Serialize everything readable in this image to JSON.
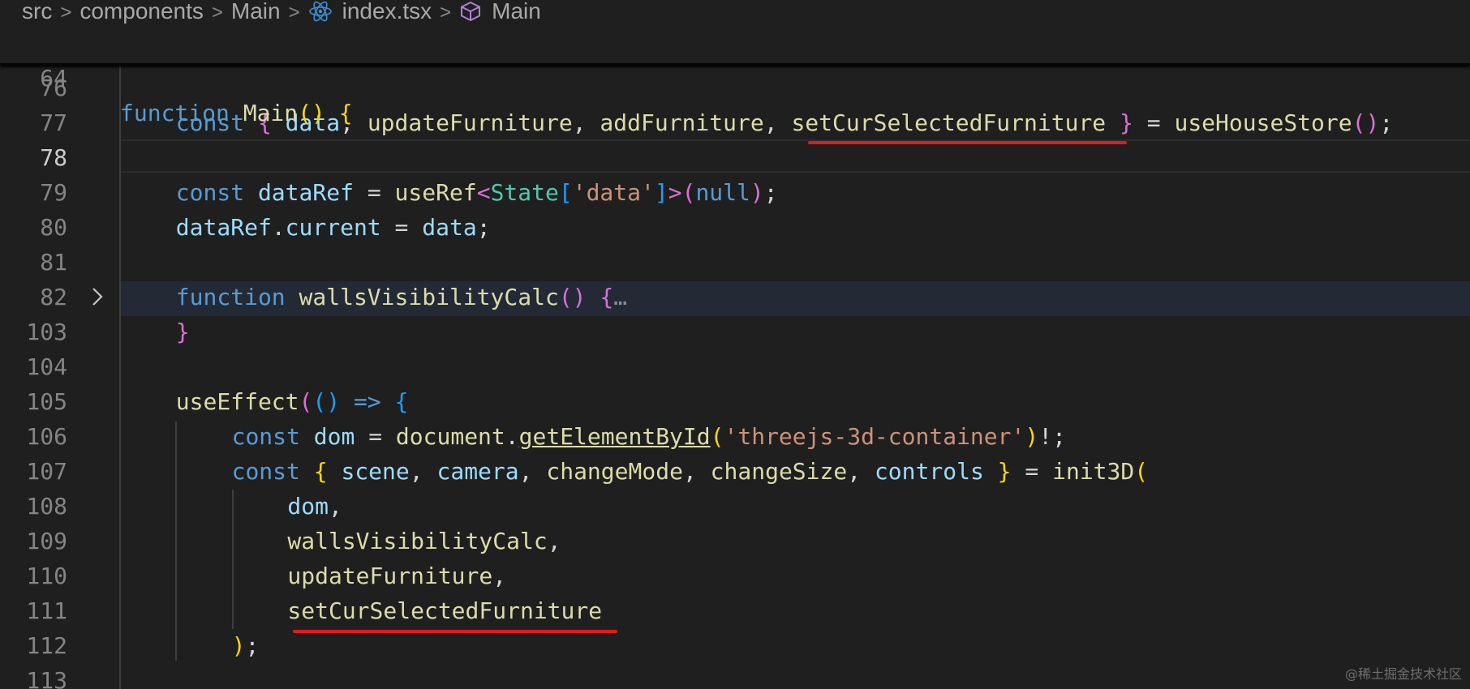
{
  "breadcrumb": {
    "items": [
      "src",
      "components",
      "Main",
      "index.tsx",
      "Main"
    ],
    "separator": ">",
    "file_icon": "react-icon",
    "symbol_icon": "cube-icon"
  },
  "sticky_scroll": {
    "line_number": "64",
    "code": "function Main() {"
  },
  "code_lines": [
    {
      "n": "76",
      "code": ""
    },
    {
      "n": "77",
      "code": "    const { data, updateFurniture, addFurniture, setCurSelectedFurniture } = useHouseStore();"
    },
    {
      "n": "78",
      "code": ""
    },
    {
      "n": "79",
      "code": "    const dataRef = useRef<State['data']>(null);"
    },
    {
      "n": "80",
      "code": "    dataRef.current = data;"
    },
    {
      "n": "81",
      "code": ""
    },
    {
      "n": "82",
      "code": "    function wallsVisibilityCalc() {…"
    },
    {
      "n": "103",
      "code": "    }"
    },
    {
      "n": "104",
      "code": ""
    },
    {
      "n": "105",
      "code": "    useEffect(() => {"
    },
    {
      "n": "106",
      "code": "        const dom = document.getElementById('threejs-3d-container')!;"
    },
    {
      "n": "107",
      "code": "        const { scene, camera, changeMode, changeSize, controls } = init3D("
    },
    {
      "n": "108",
      "code": "            dom,"
    },
    {
      "n": "109",
      "code": "            wallsVisibilityCalc,"
    },
    {
      "n": "110",
      "code": "            updateFurniture,"
    },
    {
      "n": "111",
      "code": "            setCurSelectedFurniture"
    },
    {
      "n": "112",
      "code": "        );"
    },
    {
      "n": "113",
      "code": ""
    }
  ],
  "active_line": "78",
  "folded_line": "82",
  "highlight_color": "#e21b1b",
  "watermark": "@稀土掘金技术社区"
}
